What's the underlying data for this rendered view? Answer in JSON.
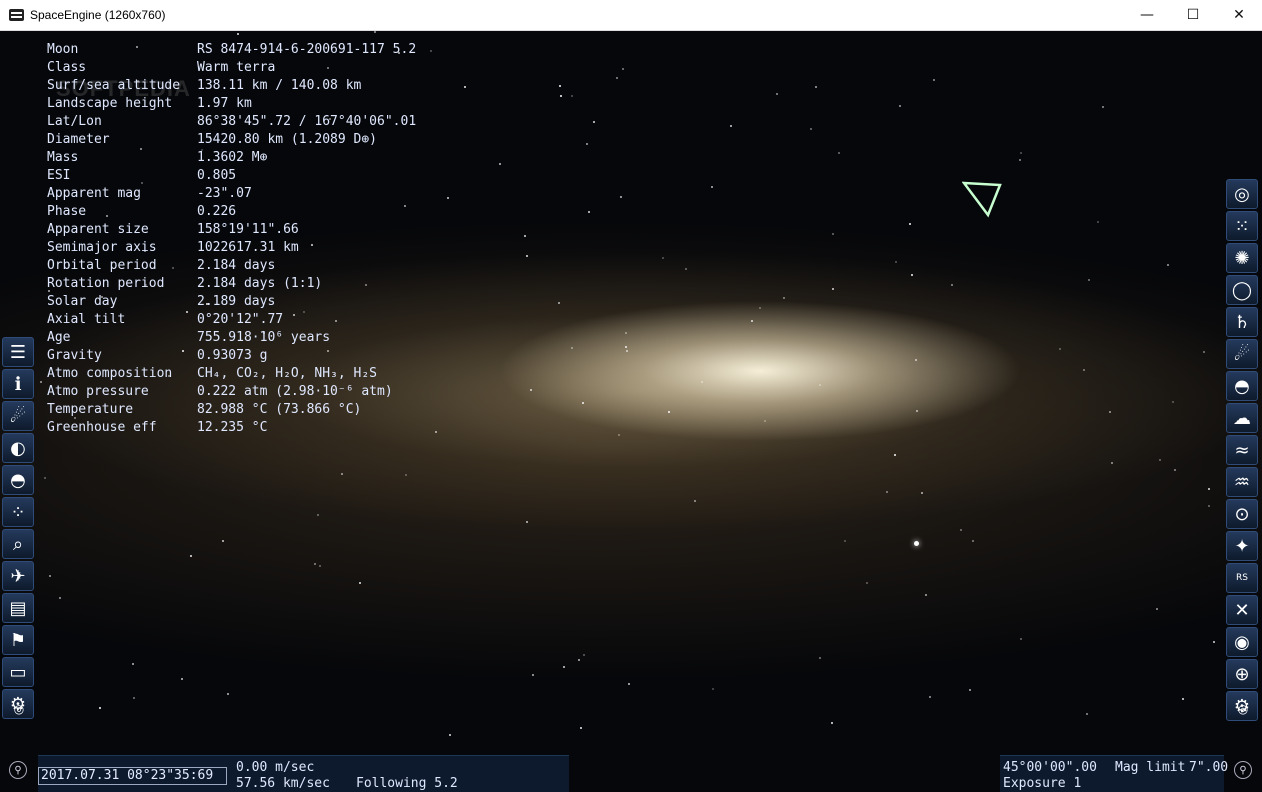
{
  "window": {
    "title": "SpaceEngine (1260x760)",
    "minimize_glyph": "—",
    "maximize_glyph": "☐",
    "close_glyph": "✕"
  },
  "watermark": "SOFTPEDIA",
  "object_info": [
    {
      "label": "Moon",
      "value": "RS 8474-914-6-200691-117 5.2"
    },
    {
      "label": "Class",
      "value": "Warm terra"
    },
    {
      "label": "Surf/sea altitude",
      "value": "138.11 km / 140.08 km"
    },
    {
      "label": "Landscape height",
      "value": "1.97 km"
    },
    {
      "label": "Lat/Lon",
      "value": "86°38'45\".72 / 167°40'06\".01"
    },
    {
      "label": "Diameter",
      "value": "15420.80 km (1.2089 D⊕)"
    },
    {
      "label": "Mass",
      "value": "1.3602 M⊕"
    },
    {
      "label": "ESI",
      "value": "0.805"
    },
    {
      "label": "Apparent mag",
      "value": "-23\".07"
    },
    {
      "label": "Phase",
      "value": "0.226"
    },
    {
      "label": "Apparent size",
      "value": "158°19'11\".66"
    },
    {
      "label": "Semimajor axis",
      "value": "1022617.31 km"
    },
    {
      "label": "Orbital period",
      "value": "2.184 days"
    },
    {
      "label": "Rotation period",
      "value": "2.184 days (1:1)"
    },
    {
      "label": "Solar day",
      "value": "2.189 days"
    },
    {
      "label": "Axial tilt",
      "value": "0°20'12\".77"
    },
    {
      "label": "Age",
      "value": "755.918·10⁶ years"
    },
    {
      "label": "Gravity",
      "value": "0.93073 g"
    },
    {
      "label": "Atmo composition",
      "value": "CH₄, CO₂, H₂O, NH₃, H₂S"
    },
    {
      "label": "Atmo pressure",
      "value": "0.222 atm (2.98·10⁻⁶ atm)"
    },
    {
      "label": "Temperature",
      "value": "82.988 °C (73.866 °C)"
    },
    {
      "label": "Greenhouse eff",
      "value": "12.235 °C"
    }
  ],
  "left_toolbar": [
    {
      "name": "menu",
      "glyph": "☰"
    },
    {
      "name": "info",
      "glyph": "ℹ"
    },
    {
      "name": "planetarium",
      "glyph": "☄"
    },
    {
      "name": "solar-system-browser",
      "glyph": "◐"
    },
    {
      "name": "planets",
      "glyph": "◓"
    },
    {
      "name": "star-browser",
      "glyph": "⁘"
    },
    {
      "name": "search",
      "glyph": "⌕"
    },
    {
      "name": "ship",
      "glyph": "✈"
    },
    {
      "name": "wiki",
      "glyph": "▤"
    },
    {
      "name": "locations",
      "glyph": "⚑"
    },
    {
      "name": "display",
      "glyph": "▭"
    },
    {
      "name": "settings",
      "glyph": "⚙"
    }
  ],
  "right_toolbar": [
    {
      "name": "galaxies",
      "glyph": "◎"
    },
    {
      "name": "star-clusters",
      "glyph": "⁙"
    },
    {
      "name": "nebulae",
      "glyph": "✺"
    },
    {
      "name": "rings",
      "glyph": "◯"
    },
    {
      "name": "planet-rings",
      "glyph": "♄"
    },
    {
      "name": "comets",
      "glyph": "☄"
    },
    {
      "name": "atmosphere",
      "glyph": "◓"
    },
    {
      "name": "clouds",
      "glyph": "☁"
    },
    {
      "name": "water",
      "glyph": "≈"
    },
    {
      "name": "aurora",
      "glyph": "♒"
    },
    {
      "name": "orbits",
      "glyph": "⊙"
    },
    {
      "name": "stars",
      "glyph": "✦"
    },
    {
      "name": "labels",
      "glyph": "RS"
    },
    {
      "name": "markers",
      "glyph": "✕"
    },
    {
      "name": "target",
      "glyph": "◉"
    },
    {
      "name": "grid",
      "glyph": "⊕"
    },
    {
      "name": "settings",
      "glyph": "⚙"
    }
  ],
  "bottom_bar": {
    "datetime": "2017.07.31 08°23\"35:69",
    "speed": "0.00 m/sec",
    "velocity": "57.56 km/sec",
    "following": "Following 5.2",
    "fov": "45°00'00\".00",
    "mag_limit_label": "Mag limit",
    "mag_limit_value": "7\".00",
    "exposure": "Exposure 1"
  },
  "colors": {
    "info_text": "#dfe8ff",
    "toolbar_bg": "#1a2e4a",
    "marker": "#c8ffd0"
  }
}
